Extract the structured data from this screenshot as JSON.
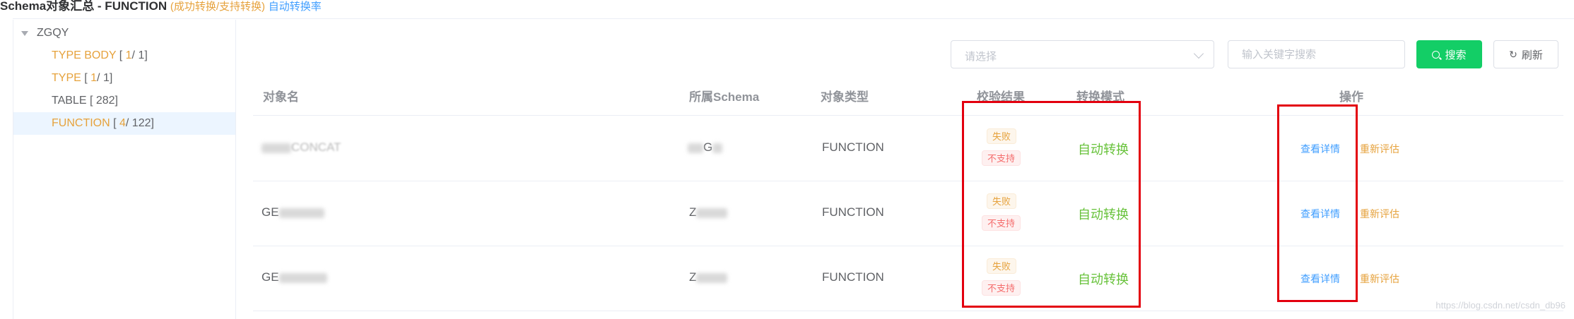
{
  "top": {
    "title": "Schema对象汇总 - FUNCTION",
    "status": "(成功转换/支持转换)",
    "link": "自动转换率"
  },
  "tree": {
    "root": "ZGQY",
    "nodes": [
      {
        "name": "TYPE BODY",
        "a": "1",
        "b": "1",
        "color": "orange"
      },
      {
        "name": "TYPE",
        "a": "1",
        "b": "1",
        "color": "orange"
      },
      {
        "name": "TABLE",
        "b": "282",
        "color": "gray"
      },
      {
        "name": "FUNCTION",
        "a": "4",
        "b": "122",
        "color": "orange",
        "selected": true
      }
    ]
  },
  "toolbar": {
    "select_placeholder": "请选择",
    "keyword_placeholder": "输入关键字搜索",
    "search_label": "搜索",
    "refresh_label": "刷新"
  },
  "table": {
    "headers": {
      "name": "对象名",
      "schema": "所属Schema",
      "type": "对象类型",
      "check": "校验结果",
      "mode": "转换模式",
      "action": "操作"
    },
    "rows": [
      {
        "name_prefix": "",
        "name_suffix": "CONCAT",
        "schema": "",
        "schema_suffix": "G",
        "type": "FUNCTION",
        "tag1": "失败",
        "tag2": "不支持",
        "mode": "自动转换",
        "view": "查看详情",
        "reeval": "重新评估"
      },
      {
        "name_prefix": "GE",
        "name_suffix": "",
        "schema": "Z",
        "schema_suffix": "",
        "type": "FUNCTION",
        "tag1": "失败",
        "tag2": "不支持",
        "mode": "自动转换",
        "view": "查看详情",
        "reeval": "重新评估"
      },
      {
        "name_prefix": "GE",
        "name_suffix": "",
        "schema": "Z",
        "schema_suffix": "",
        "type": "FUNCTION",
        "tag1": "失败",
        "tag2": "不支持",
        "mode": "自动转换",
        "view": "查看详情",
        "reeval": "重新评估"
      }
    ]
  },
  "watermark": "https://blog.csdn.net/csdn_db96",
  "colors": {
    "orange": "#E6A23C",
    "green": "#13CE66",
    "success_text": "#67C23A",
    "link": "#409EFF",
    "danger": "#F56C6C",
    "highlight_box": "#E3000E"
  }
}
